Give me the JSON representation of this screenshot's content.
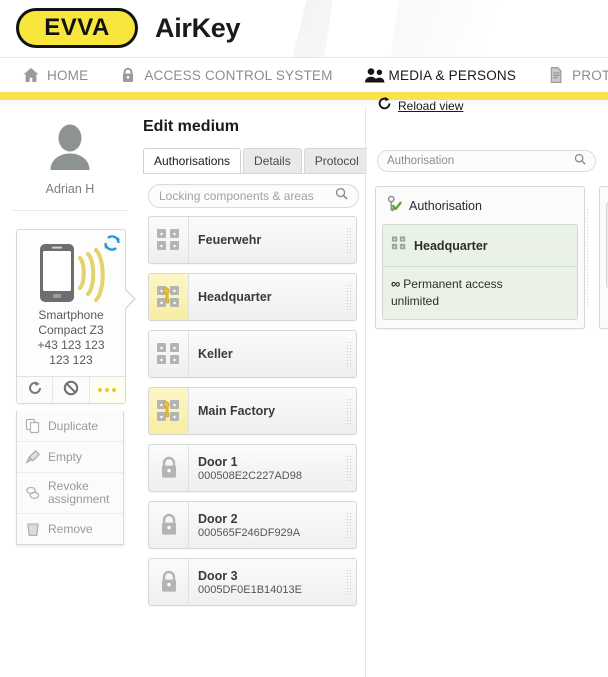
{
  "brand": {
    "logo_text": "EVVA",
    "product": "AirKey"
  },
  "nav": {
    "items": [
      {
        "label": "HOME",
        "icon": "home-icon",
        "active": false
      },
      {
        "label": "ACCESS CONTROL SYSTEM",
        "icon": "lock-icon",
        "active": false
      },
      {
        "label": "MEDIA & PERSONS",
        "icon": "people-icon",
        "active": true
      },
      {
        "label": "PROTOCOLS",
        "icon": "document-icon",
        "active": false
      },
      {
        "label": "",
        "icon": "person-icon",
        "active": false
      }
    ]
  },
  "sidebar": {
    "person": {
      "name": "Adrian H",
      "avatar_icon": "avatar-icon"
    },
    "device": {
      "sync_badge_icon": "sync-badge-icon",
      "phone_icon": "smartphone-nfc-icon",
      "line1": "Smartphone",
      "line2": "Compact Z3",
      "line3": "+43 123 123",
      "line4": "123 123",
      "actions": [
        {
          "name": "refresh",
          "icon": "refresh-icon",
          "active": false
        },
        {
          "name": "block",
          "icon": "block-icon",
          "active": false
        },
        {
          "name": "more",
          "icon": "ellipsis-icon",
          "active": true
        }
      ]
    },
    "menu": {
      "items": [
        {
          "label": "Duplicate",
          "icon": "copy-icon"
        },
        {
          "label": "Empty",
          "icon": "brush-icon"
        },
        {
          "label": "Revoke assignment",
          "icon": "revoke-icon"
        },
        {
          "label": "Remove",
          "icon": "trash-icon"
        }
      ]
    }
  },
  "main": {
    "title": "Edit medium",
    "tabs": [
      {
        "label": "Authorisations",
        "active": true
      },
      {
        "label": "Details",
        "active": false
      },
      {
        "label": "Protocol",
        "active": false
      }
    ],
    "reload": {
      "label": "Reload view",
      "icon": "reload-icon"
    },
    "search": {
      "placeholder": "Locking components & areas",
      "value": "",
      "icon": "search-icon"
    },
    "list": [
      {
        "title": "Feuerwehr",
        "subtitle": "",
        "icon": "area-locks-icon",
        "highlighted": false
      },
      {
        "title": "Headquarter",
        "subtitle": "",
        "icon": "area-locks-key-icon",
        "highlighted": true
      },
      {
        "title": "Keller",
        "subtitle": "",
        "icon": "area-locks-icon",
        "highlighted": false
      },
      {
        "title": "Main Factory",
        "subtitle": "",
        "icon": "area-locks-key-icon",
        "highlighted": true
      },
      {
        "title": "Door 1",
        "subtitle": "000508E2C227AD98",
        "icon": "lock-icon",
        "highlighted": false
      },
      {
        "title": "Door 2",
        "subtitle": "000565F246DF929A",
        "icon": "lock-icon",
        "highlighted": false
      },
      {
        "title": "Door 3",
        "subtitle": "0005DF0E1B14013E",
        "icon": "lock-icon",
        "highlighted": false
      }
    ]
  },
  "right": {
    "search": {
      "placeholder": "Authorisation",
      "value": "",
      "icon": "search-icon"
    },
    "cards": [
      {
        "header": "Authorisation",
        "header_icon": "key-check-icon",
        "name": "Headquarter",
        "name_icon": "area-locks-small-icon",
        "access_symbol": "∞",
        "access_line1": "Permanent access",
        "access_line2": "unlimited"
      }
    ]
  },
  "colors": {
    "brand_yellow": "#f8e63c",
    "bar_yellow": "#f9e34a",
    "highlight_yellow": "#f7eda4",
    "auth_green": "#eaf2e6",
    "auth_green_border": "#cfdccd"
  }
}
